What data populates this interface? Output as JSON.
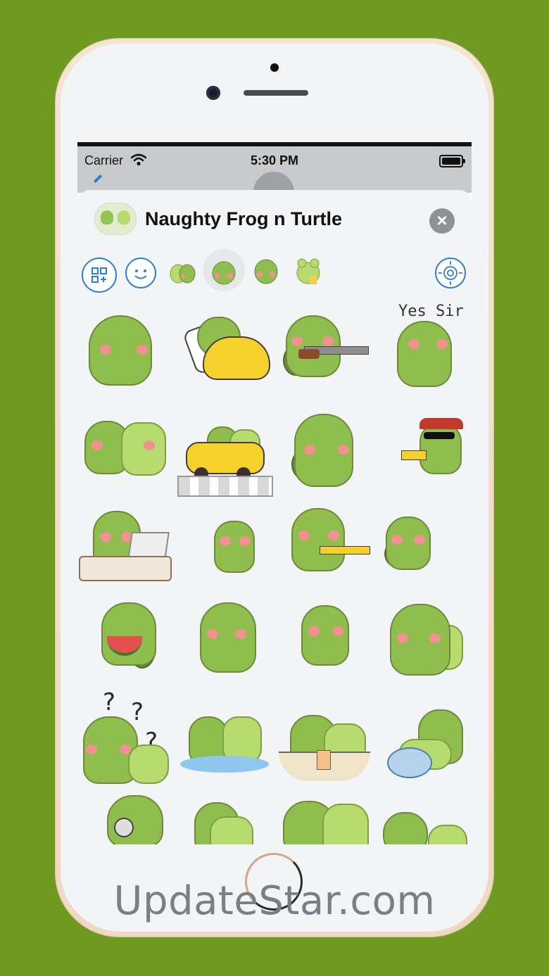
{
  "status_bar": {
    "carrier": "Carrier",
    "time": "5:30 PM"
  },
  "sheet": {
    "title": "Naughty Frog n Turtle",
    "close_icon": "close-icon"
  },
  "toolbar": {
    "icons": [
      "apps-grid-icon",
      "emoji-smile-icon",
      "sticker-pack-icon",
      "sticker-pack-icon",
      "sticker-pack-icon",
      "sticker-pack-icon",
      "locate-target-icon"
    ]
  },
  "stickers": {
    "caption_yes_sir": "Yes Sir",
    "question_mark": "?"
  },
  "watermark": "UpdateStar.com",
  "colors": {
    "background": "#6f9a22",
    "turtle_green": "#8fbe4f",
    "frog_green": "#b7db6f",
    "accent_blue": "#2b7bd8"
  }
}
